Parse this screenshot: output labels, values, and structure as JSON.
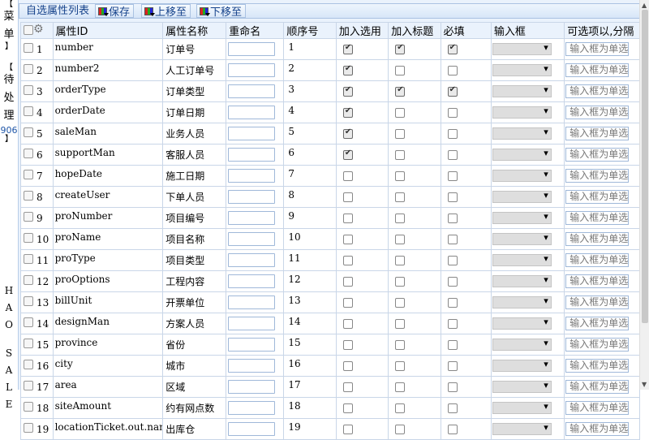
{
  "side": {
    "menu_chars": [
      "菜",
      "单"
    ],
    "pending_chars": [
      "待",
      "处",
      "理"
    ],
    "pending_count": "906",
    "brand_top": [
      "H",
      "A",
      "O"
    ],
    "brand_bottom": [
      "S",
      "A",
      "L",
      "E"
    ]
  },
  "toolbar": {
    "title": "自选属性列表",
    "save_label": "保存",
    "move_up_label": "上移至",
    "move_down_label": "下移至"
  },
  "grid": {
    "headers": {
      "attr_id": "属性ID",
      "attr_name": "属性名称",
      "rename": "重命名",
      "order": "顺序号",
      "add_select": "加入选用",
      "add_title": "加入标题",
      "required": "必填",
      "input_box": "输入框",
      "options": "可选项以,分隔"
    },
    "option_placeholder": "输入框为单选",
    "rows": [
      {
        "no": "1",
        "id": "number",
        "name": "订单号",
        "order": "1",
        "sel": true,
        "title": true,
        "req": true
      },
      {
        "no": "2",
        "id": "number2",
        "name": "人工订单号",
        "order": "2",
        "sel": true,
        "title": false,
        "req": false
      },
      {
        "no": "3",
        "id": "orderType",
        "name": "订单类型",
        "order": "3",
        "sel": true,
        "title": true,
        "req": true
      },
      {
        "no": "4",
        "id": "orderDate",
        "name": "订单日期",
        "order": "4",
        "sel": true,
        "title": false,
        "req": false
      },
      {
        "no": "5",
        "id": "saleMan",
        "name": "业务人员",
        "order": "5",
        "sel": true,
        "title": false,
        "req": false
      },
      {
        "no": "6",
        "id": "supportMan",
        "name": "客服人员",
        "order": "6",
        "sel": true,
        "title": false,
        "req": false
      },
      {
        "no": "7",
        "id": "hopeDate",
        "name": "施工日期",
        "order": "7",
        "sel": false,
        "title": false,
        "req": false
      },
      {
        "no": "8",
        "id": "createUser",
        "name": "下单人员",
        "order": "8",
        "sel": false,
        "title": false,
        "req": false
      },
      {
        "no": "9",
        "id": "proNumber",
        "name": "项目编号",
        "order": "9",
        "sel": false,
        "title": false,
        "req": false
      },
      {
        "no": "10",
        "id": "proName",
        "name": "项目名称",
        "order": "10",
        "sel": false,
        "title": false,
        "req": false
      },
      {
        "no": "11",
        "id": "proType",
        "name": "项目类型",
        "order": "11",
        "sel": false,
        "title": false,
        "req": false
      },
      {
        "no": "12",
        "id": "proOptions",
        "name": "工程内容",
        "order": "12",
        "sel": false,
        "title": false,
        "req": false
      },
      {
        "no": "13",
        "id": "billUnit",
        "name": "开票单位",
        "order": "13",
        "sel": false,
        "title": false,
        "req": false
      },
      {
        "no": "14",
        "id": "designMan",
        "name": "方案人员",
        "order": "14",
        "sel": false,
        "title": false,
        "req": false
      },
      {
        "no": "15",
        "id": "province",
        "name": "省份",
        "order": "15",
        "sel": false,
        "title": false,
        "req": false
      },
      {
        "no": "16",
        "id": "city",
        "name": "城市",
        "order": "16",
        "sel": false,
        "title": false,
        "req": false
      },
      {
        "no": "17",
        "id": "area",
        "name": "区域",
        "order": "17",
        "sel": false,
        "title": false,
        "req": false
      },
      {
        "no": "18",
        "id": "siteAmount",
        "name": "约有网点数",
        "order": "18",
        "sel": false,
        "title": false,
        "req": false
      },
      {
        "no": "19",
        "id": "locationTicket.out.name",
        "name": "出库仓",
        "order": "19",
        "sel": false,
        "title": false,
        "req": false
      }
    ]
  }
}
